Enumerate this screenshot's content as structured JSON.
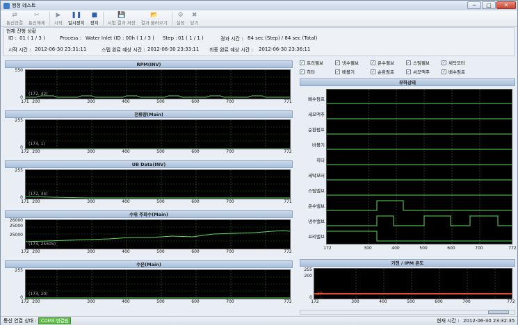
{
  "window": {
    "title": "행정 테스트",
    "min": "─",
    "max": "□",
    "close": "✕"
  },
  "toolbar": [
    {
      "name": "comm-connect",
      "label": "통신연결",
      "icon": "plug-icon",
      "glyph": "⇄",
      "enabled": false
    },
    {
      "name": "comm-disconnect",
      "label": "통신해제",
      "icon": "scissors-icon",
      "glyph": "✂",
      "enabled": false
    },
    {
      "name": "start",
      "label": "시작",
      "icon": "play-icon",
      "glyph": "▶",
      "enabled": false
    },
    {
      "name": "pause",
      "label": "일시정지",
      "icon": "pause-icon",
      "glyph": "❚❚",
      "enabled": true
    },
    {
      "name": "stop",
      "label": "정지",
      "icon": "stop-icon",
      "glyph": "■",
      "enabled": true
    },
    {
      "name": "save-result",
      "label": "시험 결과 저장",
      "icon": "save-icon",
      "glyph": "💾",
      "enabled": false
    },
    {
      "name": "load-result",
      "label": "결과 불러오기",
      "icon": "folder-icon",
      "glyph": "📂",
      "enabled": false
    },
    {
      "name": "settings",
      "label": "설정",
      "icon": "gear-icon",
      "glyph": "⚙",
      "enabled": false
    },
    {
      "name": "close",
      "label": "닫기",
      "icon": "close-icon",
      "glyph": "✖",
      "enabled": false
    }
  ],
  "status": {
    "header": "현재 진행 상황",
    "id_label": "ID :",
    "id_value": "01 ( 1 / 3 )",
    "process_label": "Process :",
    "process_value": "Water Inlet (ID : 00h ( 1 / 3 )",
    "step_label": "Step :",
    "step_value": "01 ( 1 / 1 )",
    "elapsed_label": "경과 시간 :",
    "elapsed_value": "84 sec (Step) / 84 sec (Total)",
    "start_label": "시작 시간 :",
    "start_value": "2012-06-30 23:31:11",
    "step_end_label": "스텝 완료 예상 시간 :",
    "step_end_value": "2012-06-30 23:33:11",
    "final_end_label": "최종 완료 예상 시간 :",
    "final_end_value": "2012-06-30 23:36:11"
  },
  "charts": [
    {
      "id": "rpm",
      "title": "RPM(INV)",
      "ymax": "550",
      "ymin": "0",
      "readout": "(172, 42)",
      "xticks": [
        "171",
        "200",
        "300",
        "400",
        "500",
        "600",
        "700",
        "771"
      ]
    },
    {
      "id": "current",
      "title": "전류량(Main)",
      "ymax": "255",
      "ymin": "0",
      "readout": "(173, 1)",
      "xticks": [
        "172",
        "200",
        "300",
        "400",
        "500",
        "600",
        "700",
        "772"
      ]
    },
    {
      "id": "ub",
      "title": "UB Data(INV)",
      "ymax": "255",
      "ymin": "0",
      "readout": "(172, 34)",
      "xticks": [
        "171",
        "200",
        "300",
        "400",
        "500",
        "600",
        "700",
        "771"
      ]
    },
    {
      "id": "freq",
      "title": "수위 주파수(Main)",
      "ytop": "26000",
      "ymid": "25000",
      "ymin": "25000",
      "readout": "(173, 25505)",
      "xticks": [
        "172",
        "200",
        "300",
        "400",
        "500",
        "600",
        "700",
        "772"
      ]
    },
    {
      "id": "level",
      "title": "수온(Main)",
      "ymax": "255",
      "ymin": "0",
      "readout": "(173, 20)",
      "xticks": [
        "172",
        "200",
        "300",
        "400",
        "500",
        "600",
        "700",
        "772"
      ]
    }
  ],
  "loads": [
    {
      "label": "프리웰브",
      "checked": true
    },
    {
      "label": "냉수웰브",
      "checked": true
    },
    {
      "label": "온수웰브",
      "checked": true
    },
    {
      "label": "스팀웰브",
      "checked": true
    },
    {
      "label": "세탁모터",
      "checked": true
    },
    {
      "label": "히터",
      "checked": true
    },
    {
      "label": "배볼기",
      "checked": true
    },
    {
      "label": "순환펌프",
      "checked": true
    },
    {
      "label": "씨모액추",
      "checked": true
    },
    {
      "label": "배수펌프",
      "checked": true
    }
  ],
  "load_chart": {
    "title": "부하상태",
    "rows": [
      "배수펌프",
      "세모액추",
      "순환펌프",
      "바볼기",
      "히터",
      "세탁모터",
      "스팀밸브",
      "온수밸브",
      "냉수밸브",
      "프리밸브"
    ],
    "xticks": [
      "172",
      "300",
      "400",
      "500",
      "600",
      "700",
      "772"
    ]
  },
  "temp_chart": {
    "title": "가전 / IPM 온도",
    "ymax": "255",
    "ymid": "200",
    "ymin": "0",
    "readout": "37",
    "xticks": [
      "172",
      "300",
      "400",
      "500",
      "600",
      "700",
      "772"
    ]
  },
  "statusbar": {
    "conn_label": "통신 연결 상태 :",
    "conn_value": "COM3 연결됨",
    "time_label": "현재 시간 :",
    "time_value": "2012-06-30 23:32:35"
  },
  "colors": {
    "trace": "#5fdc5f",
    "grid": "#3a6a3a",
    "temp": "#e4502a"
  }
}
